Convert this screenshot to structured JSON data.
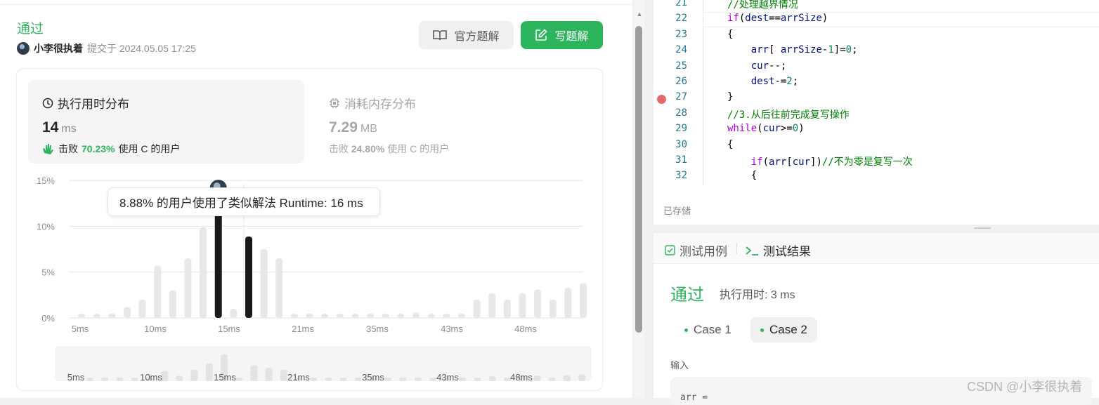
{
  "header": {
    "status": "通过",
    "user": "小李很执着",
    "submitted_text": "提交于 2024.05.05 17:25",
    "official_solution_label": "官方题解",
    "write_solution_label": "写题解"
  },
  "runtime": {
    "title": "执行用时分布",
    "value": "14",
    "unit": "ms",
    "beats_prefix": "击败",
    "beats_pct": "70.23%",
    "beats_suffix": "使用 C 的用户"
  },
  "memory": {
    "title": "消耗内存分布",
    "value": "7.29",
    "unit": "MB",
    "beats_prefix": "击败",
    "beats_pct": "24.80%",
    "beats_suffix": "使用 C 的用户"
  },
  "tooltip": "8.88% 的用户使用了类似解法 Runtime: 16 ms",
  "chart_data": {
    "type": "bar",
    "ylim": [
      0,
      15
    ],
    "yticks": [
      "15%",
      "10%",
      "5%",
      "0%"
    ],
    "ytick_values": [
      15,
      10,
      5,
      0
    ],
    "xtick_labels": [
      "5ms",
      "10ms",
      "15ms",
      "21ms",
      "35ms",
      "43ms",
      "48ms"
    ],
    "values": [
      0.4,
      0.4,
      0.4,
      1.2,
      2.0,
      5.7,
      3.0,
      6.5,
      9.9,
      15.0,
      1.0,
      8.88,
      7.5,
      6.5,
      0.4,
      0.4,
      0.4,
      0.4,
      0.4,
      0.4,
      0.4,
      0.4,
      0.6,
      0.4,
      0.4,
      0.4,
      2.0,
      2.7,
      2.0,
      2.7,
      3.1,
      2.0,
      3.3,
      3.8
    ],
    "highlighted_indices": [
      9,
      11
    ],
    "overview_xtick_labels": [
      "5ms",
      "10ms",
      "15ms",
      "21ms",
      "35ms",
      "43ms",
      "48ms"
    ]
  },
  "editor": {
    "lines": [
      {
        "n": "21",
        "html": "<span class='cm'>//处理越界情况</span>"
      },
      {
        "n": "22",
        "html": "<span class='kw'>if</span>(<span class='var'>dest</span>==<span class='var'>arrSize</span>)"
      },
      {
        "n": "23",
        "html": "{"
      },
      {
        "n": "24",
        "html": "    <span class='var'>arr</span>[ <span class='var'>arrSize</span>-<span class='num'>1</span>]=<span class='num'>0</span>;"
      },
      {
        "n": "25",
        "html": "    <span class='var'>cur</span>--;"
      },
      {
        "n": "26",
        "html": "    <span class='var'>dest</span>-=<span class='num'>2</span>;"
      },
      {
        "n": "27",
        "html": "}"
      },
      {
        "n": "28",
        "html": "<span class='cm'>//3.从后往前完成复写操作</span>"
      },
      {
        "n": "29",
        "html": "<span class='kw'>while</span>(<span class='var'>cur</span>>=<span class='num'>0</span>)"
      },
      {
        "n": "30",
        "html": "{"
      },
      {
        "n": "31",
        "html": "    <span class='kw'>if</span>(<span class='var'>arr</span>[<span class='var'>cur</span>])<span class='cm'>//不为零是复写一次</span>"
      },
      {
        "n": "32",
        "html": "    {"
      }
    ],
    "saved_label": "已存储"
  },
  "tests": {
    "tab_cases": "测试用例",
    "tab_results": "测试结果",
    "result_status": "通过",
    "result_time": "执行用时: 3 ms",
    "case1": "Case 1",
    "case2": "Case 2",
    "input_label": "输入",
    "input_text": "arr ="
  },
  "watermark": "CSDN @小李很执着",
  "colors": {
    "accent": "#2db55d",
    "bar_dark": "#1a1a1a",
    "bar_light": "#e8e8e8"
  }
}
